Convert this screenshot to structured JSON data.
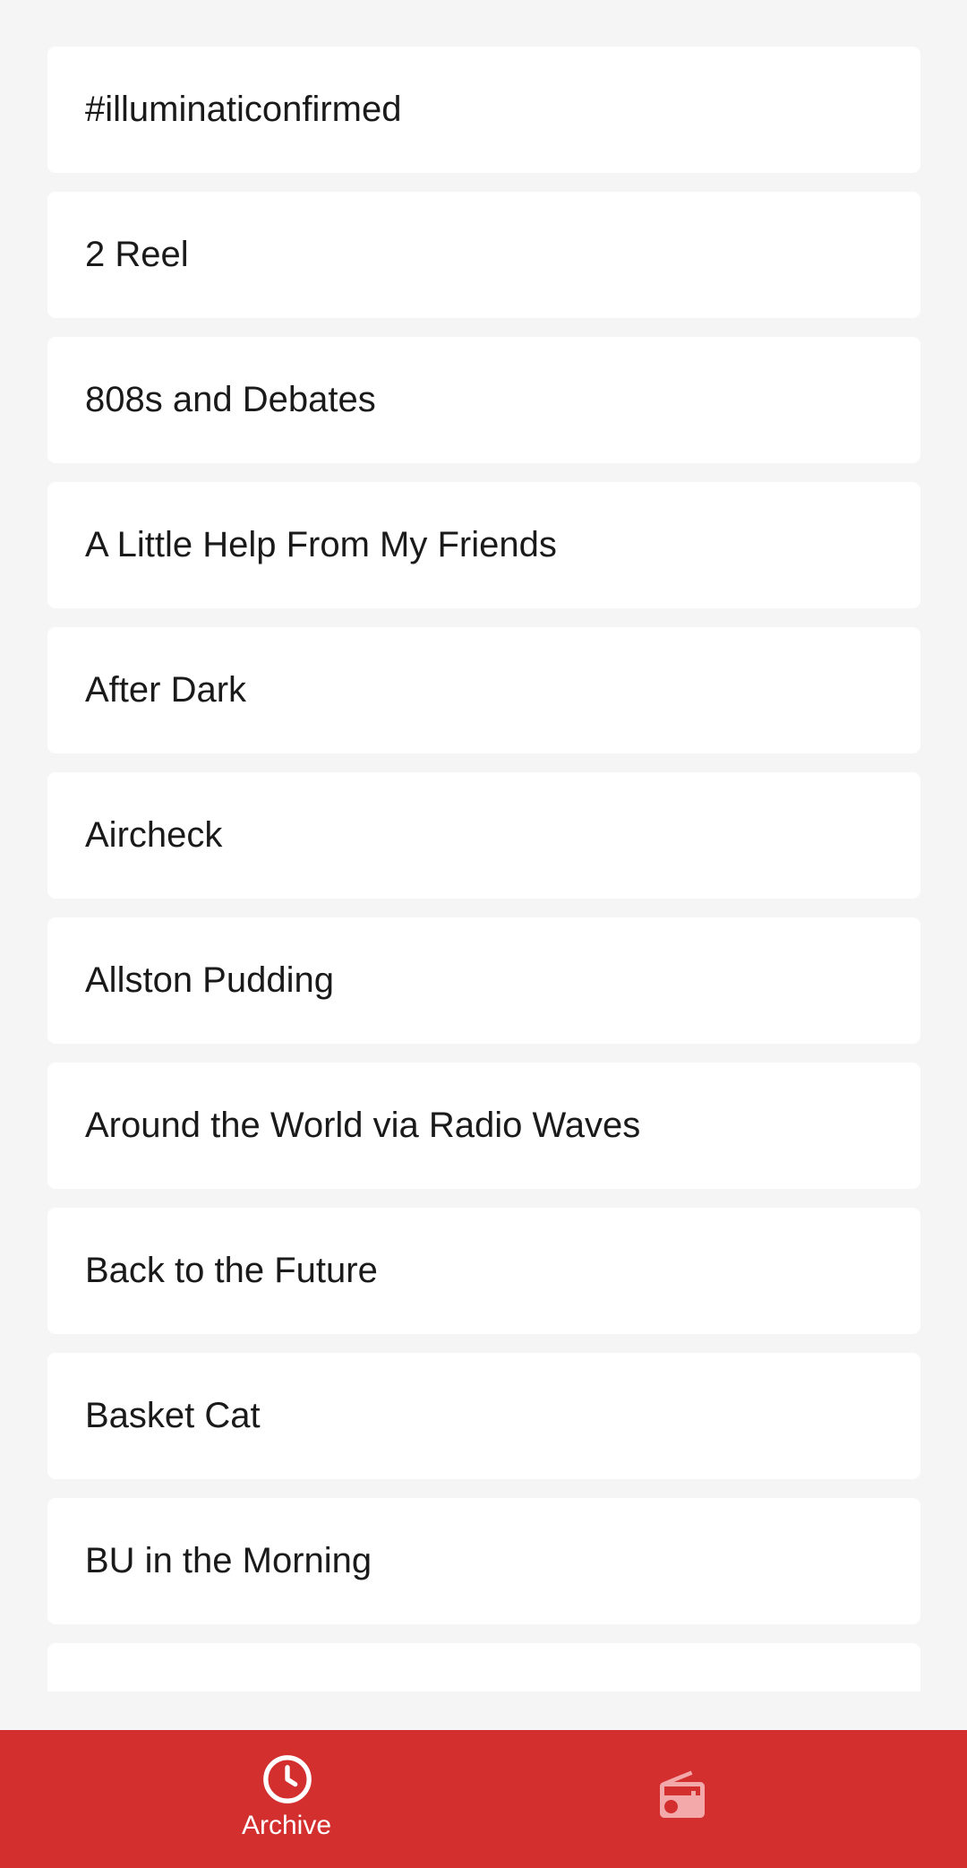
{
  "shows": [
    "#illuminaticonfirmed",
    "2 Reel",
    "808s and Debates",
    "A Little Help From My Friends",
    "After Dark",
    "Aircheck",
    "Allston Pudding",
    "Around the World via Radio Waves",
    "Back to the Future",
    "Basket Cat",
    "BU in the Morning",
    ""
  ],
  "bottom_nav": {
    "archive": {
      "label": "Archive",
      "icon": "clock-icon",
      "active": true
    },
    "live": {
      "icon": "radio-icon",
      "active": false
    }
  },
  "colors": {
    "accent": "#d32f2f",
    "background": "#f5f5f5",
    "card": "#ffffff",
    "text": "#1a1a1a",
    "nav_active": "#ffffff",
    "nav_inactive": "#f3a9a9"
  }
}
